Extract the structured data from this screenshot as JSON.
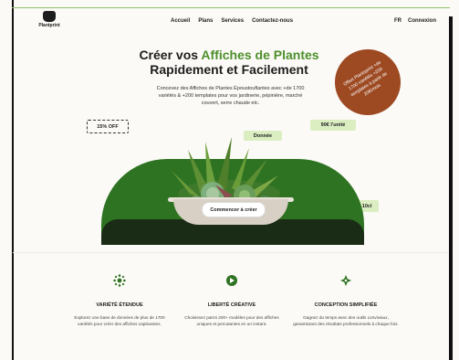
{
  "nav": {
    "logo_text": "Plantprint",
    "links": [
      "Accueil",
      "Plans",
      "Services",
      "Contactez-nous"
    ],
    "right_links": [
      "FR",
      "Connexion"
    ]
  },
  "hero": {
    "title_line1_prefix": "Créer vos ",
    "title_line1_highlight": "Affiches de Plantes",
    "title_line2": "Rapidement et Facilement",
    "description": "Concevez des Affiches de Plantes Époustouflantes avec +de 1700 variétés & +200 templates pour vos jardinerie, pépinière, marché couvert, serre chaude etc.",
    "badge_text": "Offert Plantsprint +de 1700 variétés +200 templates à partir de 20€/mois",
    "chip_discount": "15% OFF",
    "chip_data": "Donnée",
    "chip_price": "90€ l'unité",
    "chip_pot": "Pot de 10cl",
    "cta_label": "Commencer à créer"
  },
  "features": [
    {
      "icon": "sparkle-icon",
      "title": "VARIÉTÉ ÉTENDUE",
      "text": "Explorez une base de données de plus de 1700 variétés pour créer des affiches captivantes."
    },
    {
      "icon": "creative-icon",
      "title": "LIBERTÉ CRÉATIVE",
      "text": "Choisissez parmi 200+ modèles pour des affiches uniques et percutantes en un instant."
    },
    {
      "icon": "design-icon",
      "title": "CONCEPTION SIMPLIFIÉE",
      "text": "Gagnez du temps avec des outils conviviaux, garantissant des résultats professionnels à chaque fois."
    }
  ],
  "colors": {
    "brand_green": "#2e7322",
    "dark_green": "#1b2c16",
    "badge_brown": "#9d4a23",
    "chip_light": "#dbeec2"
  }
}
